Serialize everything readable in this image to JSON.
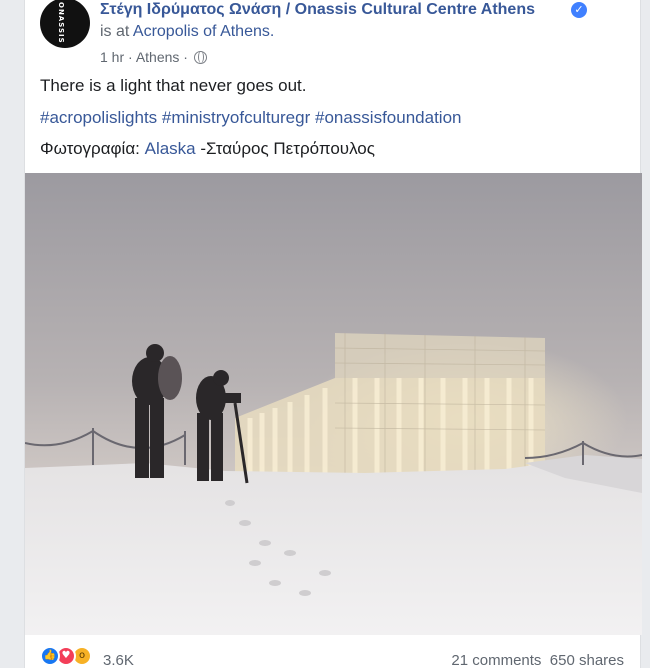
{
  "post": {
    "page_name": "Στέγη Ιδρύματος Ωνάση / Onassis Cultural Centre Athens",
    "avatar_text": "ONASSIS",
    "checkin_prefix": "is at",
    "checkin_place": "Acropolis of Athens.",
    "time": "1 hr",
    "separator": "·",
    "location": "Athens",
    "text_line1": "There is a light that never goes out.",
    "hashtags": [
      "#acropolislights",
      "#ministryofculturegr",
      "#onassisfoundation"
    ],
    "photo_credit_label": "Φωτογραφία:",
    "photo_credit_link": "Alaska",
    "photo_credit_name": "-Σταύρος Πετρόπουλος"
  },
  "footer": {
    "reaction_count": "3.6K",
    "comments": "21 comments",
    "shares": "650 shares"
  },
  "icons": {
    "like": "thumbs-up-icon",
    "love": "heart-icon",
    "wow": "wow-icon",
    "globe": "globe-icon",
    "verified": "verified-badge-icon"
  },
  "colors": {
    "link": "#385898",
    "meta": "#606770",
    "like": "#1877f2",
    "love": "#f33e58",
    "wow": "#f7b125"
  }
}
